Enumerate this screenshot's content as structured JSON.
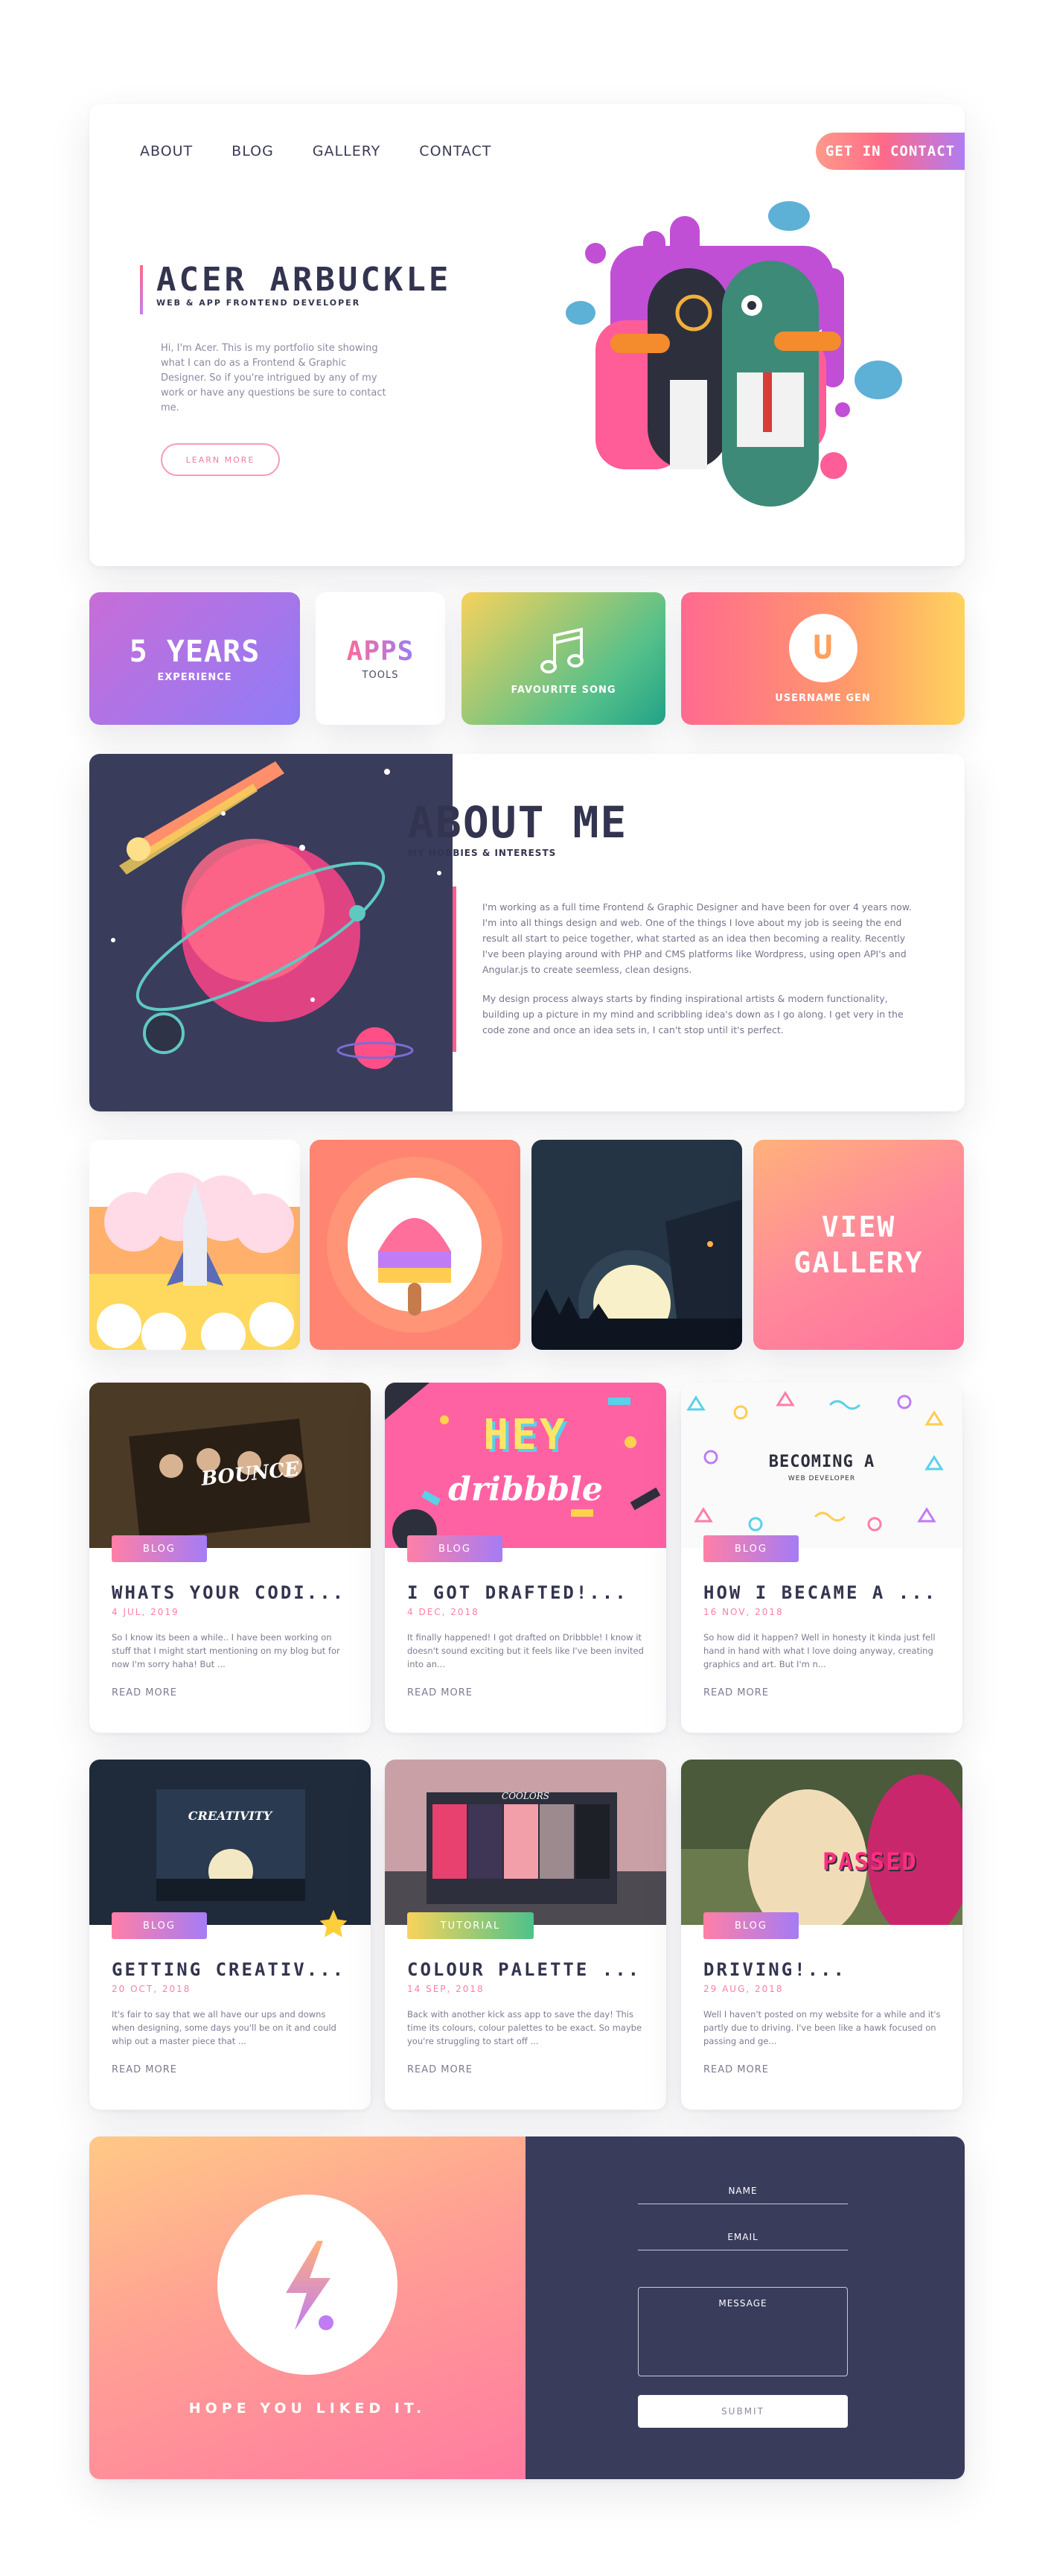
{
  "nav": {
    "items": [
      "ABOUT",
      "BLOG",
      "GALLERY",
      "CONTACT"
    ],
    "cta": "GET IN CONTACT"
  },
  "hero": {
    "name": "ACER ARBUCKLE",
    "subtitle": "WEB & APP FRONTEND DEVELOPER",
    "text": "Hi, I'm Acer. This is my portfolio site showing what I can do as a Frontend & Graphic Designer. So if you're intrigued by any of my work or have any questions be sure to contact me.",
    "button": "LEARN MORE"
  },
  "stats": {
    "years_big": "5 YEARS",
    "years_small": "EXPERIENCE",
    "apps_big": "APPS",
    "apps_small": "TOOLS",
    "song_small": "FAVOURITE SONG",
    "user_letter": "U",
    "user_small": "USERNAME GEN"
  },
  "about": {
    "title": "ABOUT ME",
    "subtitle": "MY HOBBIES & INTERESTS",
    "p1": "I'm working as a full time Frontend & Graphic Designer and have been for over 4 years now. I'm into all things design and web. One of the things I love about my job is seeing the end result all start to peice together, what started as an idea then becoming a reality. Recently I've been playing around with PHP and CMS platforms like Wordpress, using open API's and Angular.js to create seemless, clean designs.",
    "p2": "My design process always starts by finding inspirational artists & modern functionality, building up a picture in my mind and scribbling idea's down as I go along. I get very in the code zone and once an idea sets in, I can't stop until it's perfect."
  },
  "gallery": {
    "view_label": "VIEW GALLERY"
  },
  "posts": [
    {
      "tag": "BLOG",
      "title": "WHATS YOUR CODI...",
      "date": "4 JUL, 2019",
      "excerpt": "So I know its been a while.. I have been working on stuff that I might start mentioning on my blog but for now I'm sorry haha! But ...",
      "more": "READ MORE",
      "thumb_text": "BOUNCE"
    },
    {
      "tag": "BLOG",
      "title": "I GOT DRAFTED!...",
      "date": "4 DEC, 2018",
      "excerpt": "It finally happened! I got drafted on Dribbble! I know it doesn't sound exciting but it feels like I've been invited into an...",
      "more": "READ MORE",
      "thumb_text": "HEY",
      "thumb_text2": "dribbble"
    },
    {
      "tag": "BLOG",
      "title": "HOW I BECAME A ...",
      "date": "16 NOV, 2018",
      "excerpt": "So how did it happen? Well in honesty it kinda just fell hand in hand with what I love doing anyway, creating graphics and art. But I'm n...",
      "more": "READ MORE",
      "thumb_text": "BECOMING A",
      "thumb_text2": "WEB DEVELOPER"
    },
    {
      "tag": "BLOG",
      "title": "GETTING CREATIV...",
      "date": "20 OCT, 2018",
      "excerpt": "It's fair to say that we all have our ups and downs when designing, some days you'll be on it and could whip out a master piece that ...",
      "more": "READ MORE",
      "thumb_text": "CREATIVITY"
    },
    {
      "tag": "TUTORIAL",
      "title": "COLOUR PALETTE ...",
      "date": "14 SEP, 2018",
      "excerpt": "Back with another kick ass app to save the day! This time its colours, colour palettes to be exact. So maybe you're struggling to start off ...",
      "more": "READ MORE",
      "thumb_text": "COOLORS"
    },
    {
      "tag": "BLOG",
      "title": "DRIVING!...",
      "date": "29 AUG, 2018",
      "excerpt": "Well I haven't posted on my website for a while and it's partly due to driving. I've been like a hawk focused on passing and ge...",
      "more": "READ MORE",
      "thumb_text": "PASSED"
    }
  ],
  "footer": {
    "tagline": "HOPE YOU LIKED IT.",
    "name": "NAME",
    "email": "EMAIL",
    "message": "MESSAGE",
    "submit": "SUBMIT"
  },
  "colors": {
    "dark": "#33344f",
    "navy": "#3a3c5c",
    "pink": "#ff6a88",
    "purple": "#9b7cf4",
    "peach": "#ffb17a"
  }
}
